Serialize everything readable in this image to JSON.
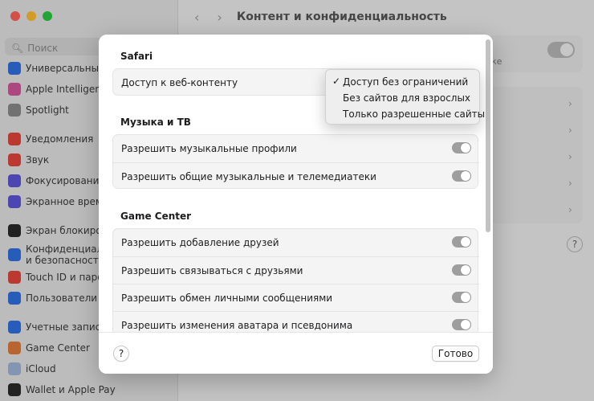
{
  "window": {
    "title": "Контент и конфиденциальность",
    "search_placeholder": "Поиск"
  },
  "sidebar": {
    "items": [
      {
        "label": "Универсальный",
        "color": "#2f6fe0"
      },
      {
        "label": "Apple Intelligence",
        "color": "#d0569a"
      },
      {
        "label": "Spotlight",
        "color": "#8a8a8a"
      },
      {
        "label": "Уведомления",
        "color": "#e2453c"
      },
      {
        "label": "Звук",
        "color": "#e2453c"
      },
      {
        "label": "Фокусирование",
        "color": "#5b55d6"
      },
      {
        "label": "Экранное время",
        "color": "#5b55d6"
      },
      {
        "label": "Экран блокиров",
        "color": "#2a2a2a"
      },
      {
        "label": "Конфиденциаль\nи безопасность",
        "color": "#2f6fe0"
      },
      {
        "label": "Touch ID и паро",
        "color": "#e2453c"
      },
      {
        "label": "Пользователи и",
        "color": "#2f6fe0"
      },
      {
        "label": "Учетные записи",
        "color": "#2f6fe0"
      },
      {
        "label": "Game Center",
        "color": "#e07a3a"
      },
      {
        "label": "iCloud",
        "color": "#9fb4d8"
      },
      {
        "label": "Wallet и Apple Pay",
        "color": "#2a2a2a"
      }
    ]
  },
  "bg": {
    "partial_text": "ке"
  },
  "sheet": {
    "sections": [
      {
        "title": "Safari",
        "rows": [
          {
            "label": "Доступ к веб-контенту"
          }
        ]
      },
      {
        "title": "Музыка и ТВ",
        "rows": [
          {
            "label": "Разрешить музыкальные профили",
            "on": true
          },
          {
            "label": "Разрешить общие музыкальные и телемедиатеки",
            "on": true
          }
        ]
      },
      {
        "title": "Game Center",
        "rows": [
          {
            "label": "Разрешить добавление друзей",
            "on": true
          },
          {
            "label": "Разрешить связываться с друзьями",
            "on": true
          },
          {
            "label": "Разрешить обмен личными сообщениями",
            "on": true
          },
          {
            "label": "Разрешить изменения аватара и псевдонима",
            "on": true
          }
        ]
      }
    ],
    "menu": {
      "options": [
        "Доступ без ограничений",
        "Без сайтов для взрослых",
        "Только разрешенные сайты"
      ],
      "selected_index": 0,
      "check_glyph": "✓"
    },
    "footer": {
      "help_label": "?",
      "done_label": "Готово"
    }
  }
}
